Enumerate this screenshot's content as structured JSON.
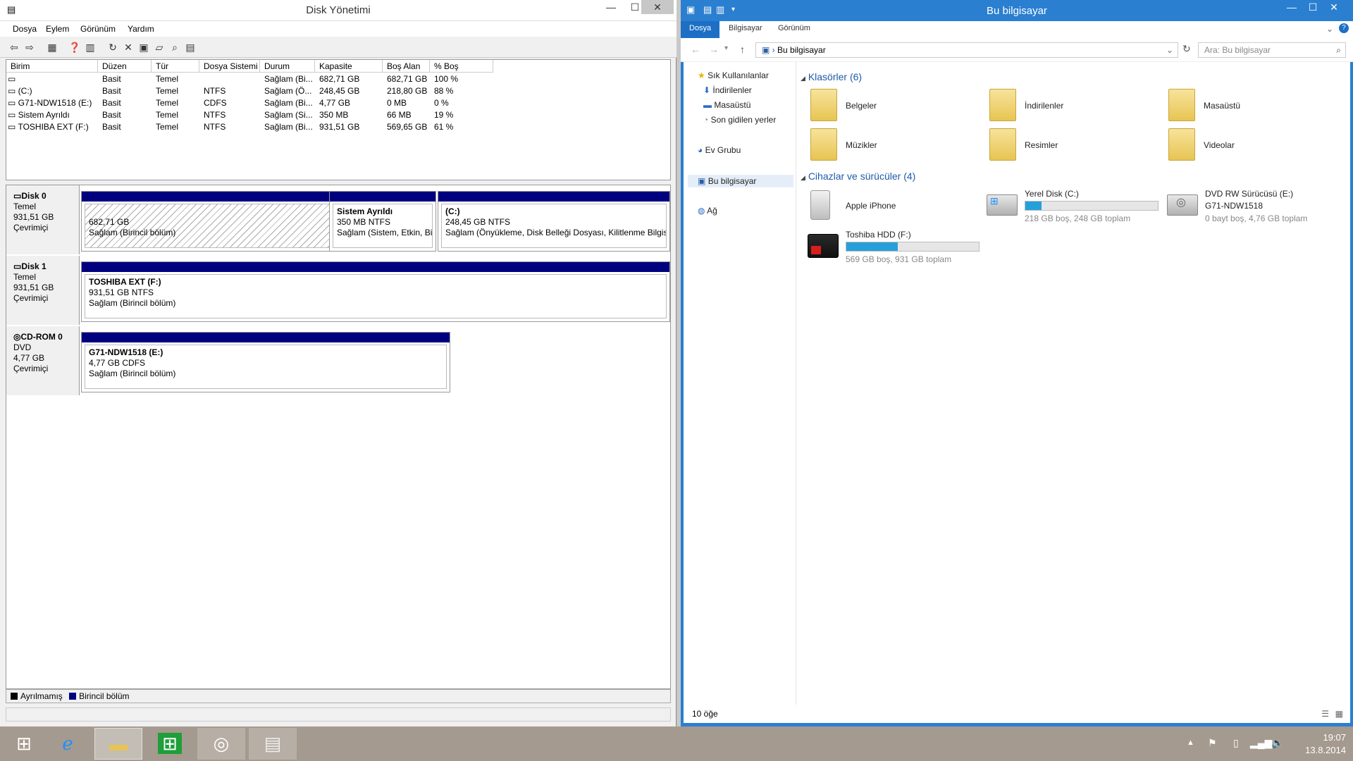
{
  "disk_management": {
    "title": "Disk Yönetimi",
    "menu": [
      "Dosya",
      "Eylem",
      "Görünüm",
      "Yardım"
    ],
    "columns": [
      "Birim",
      "Düzen",
      "Tür",
      "Dosya Sistemi",
      "Durum",
      "Kapasite",
      "Boş Alan",
      "% Boş"
    ],
    "volumes": [
      {
        "name": "",
        "layout": "Basit",
        "type": "Temel",
        "fs": "",
        "status": "Sağlam (Bi...",
        "capacity": "682,71 GB",
        "free": "682,71 GB",
        "pct": "100 %"
      },
      {
        "name": "(C:)",
        "layout": "Basit",
        "type": "Temel",
        "fs": "NTFS",
        "status": "Sağlam (Ö...",
        "capacity": "248,45 GB",
        "free": "218,80 GB",
        "pct": "88 %"
      },
      {
        "name": "G71-NDW1518 (E:)",
        "layout": "Basit",
        "type": "Temel",
        "fs": "CDFS",
        "status": "Sağlam (Bi...",
        "capacity": "4,77 GB",
        "free": "0 MB",
        "pct": "0 %"
      },
      {
        "name": "Sistem Ayrıldı",
        "layout": "Basit",
        "type": "Temel",
        "fs": "NTFS",
        "status": "Sağlam (Si...",
        "capacity": "350 MB",
        "free": "66 MB",
        "pct": "19 %"
      },
      {
        "name": "TOSHIBA EXT (F:)",
        "layout": "Basit",
        "type": "Temel",
        "fs": "NTFS",
        "status": "Sağlam (Bi...",
        "capacity": "931,51 GB",
        "free": "569,65 GB",
        "pct": "61 %"
      }
    ],
    "disks": [
      {
        "name": "Disk 0",
        "kind": "Temel",
        "size": "931,51 GB",
        "state": "Çevrimiçi",
        "parts": [
          {
            "title": "",
            "line1": "682,71 GB",
            "line2": "Sağlam (Birincil bölüm)"
          },
          {
            "title": "Sistem Ayrıldı",
            "line1": "350 MB NTFS",
            "line2": "Sağlam (Sistem, Etkin, Biri"
          },
          {
            "title": "(C:)",
            "line1": "248,45 GB NTFS",
            "line2": "Sağlam (Önyükleme, Disk Belleği Dosyası, Kilitlenme Bilgisi,"
          }
        ]
      },
      {
        "name": "Disk 1",
        "kind": "Temel",
        "size": "931,51 GB",
        "state": "Çevrimiçi",
        "parts": [
          {
            "title": "TOSHIBA EXT  (F:)",
            "line1": "931,51 GB NTFS",
            "line2": "Sağlam (Birincil bölüm)"
          }
        ]
      },
      {
        "name": "CD-ROM 0",
        "kind": "DVD",
        "size": "4,77 GB",
        "state": "Çevrimiçi",
        "parts": [
          {
            "title": "G71-NDW1518  (E:)",
            "line1": "4,77 GB CDFS",
            "line2": "Sağlam (Birincil bölüm)"
          }
        ]
      }
    ],
    "legend": {
      "unallocated": "Ayrılmamış",
      "primary": "Birincil bölüm"
    }
  },
  "explorer": {
    "title": "Bu bilgisayar",
    "tabs": [
      "Dosya",
      "Bilgisayar",
      "Görünüm"
    ],
    "address": "Bu bilgisayar",
    "search_placeholder": "Ara: Bu bilgisayar",
    "nav": {
      "favorites": "Sık Kullanılanlar",
      "fav_items": [
        "İndirilenler",
        "Masaüstü",
        "Son gidilen yerler"
      ],
      "homegroup": "Ev Grubu",
      "thispc": "Bu bilgisayar",
      "network": "Ağ"
    },
    "folders_header": "Klasörler (6)",
    "folders": [
      "Belgeler",
      "İndirilenler",
      "Masaüstü",
      "Müzikler",
      "Resimler",
      "Videolar"
    ],
    "devices_header": "Cihazlar ve sürücüler (4)",
    "devices": {
      "iphone": "Apple iPhone",
      "c_name": "Yerel Disk (C:)",
      "c_info": "218 GB boş, 248 GB toplam",
      "c_used_fraction": 0.12,
      "dvd_name": "DVD RW Sürücüsü (E:)",
      "dvd_label": "G71-NDW1518",
      "dvd_info": "0 bayt boş, 4,76 GB toplam",
      "f_name": "Toshiba HDD (F:)",
      "f_info": "569 GB boş, 931 GB toplam",
      "f_used_fraction": 0.39
    },
    "status": "10 öğe"
  },
  "taskbar": {
    "time": "19:07",
    "date": "13.8.2014"
  }
}
